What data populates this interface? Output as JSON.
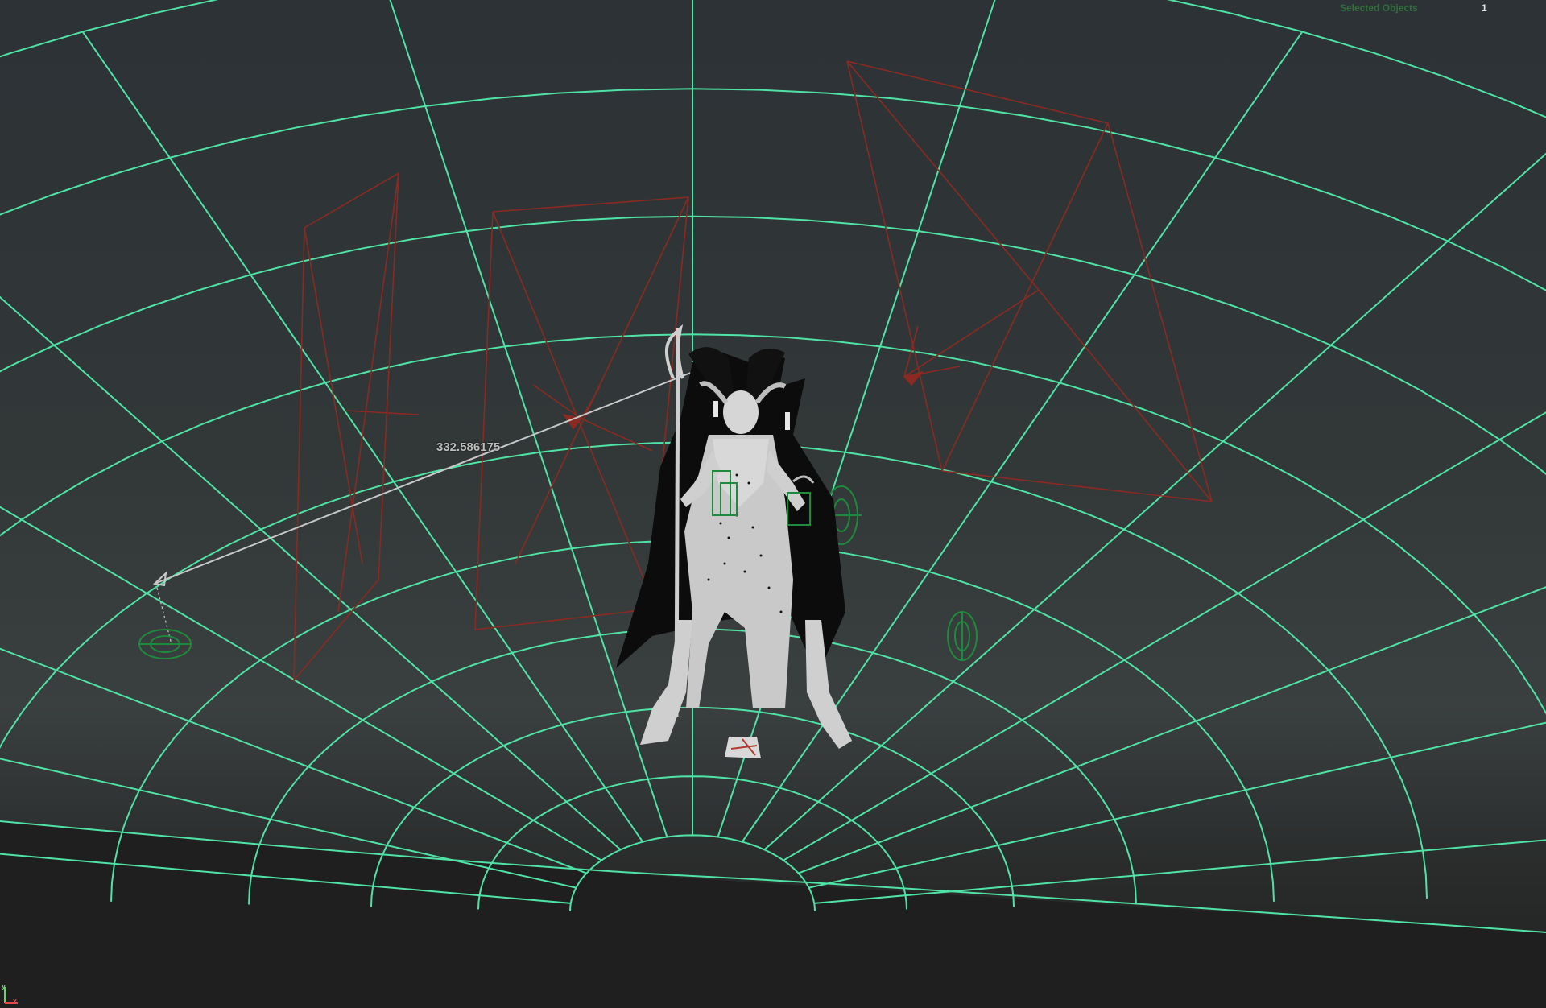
{
  "viewport": {
    "hud": {
      "selected_objects_label": "Selected Objects",
      "selected_objects_value": "1"
    },
    "measure": {
      "distance_label": "332.586175"
    },
    "axis_gizmo": {
      "y_label": "y",
      "x_label": "x"
    }
  },
  "colors": {
    "grid": "#4fe3a6",
    "camera_frustum": "#8a2a22",
    "measure_line": "#c8c8c8",
    "light_locator": "#1e8a3c",
    "background_top": "#2c3235",
    "floor_shadow": "#202020"
  },
  "icons": [
    "camera-frustum-icon",
    "light-locator-icon",
    "axis-gizmo-icon"
  ]
}
